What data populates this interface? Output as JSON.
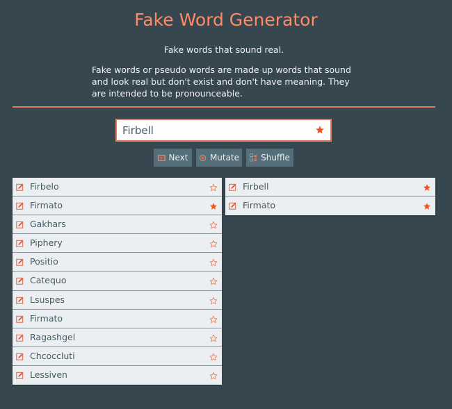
{
  "header": {
    "title": "Fake Word Generator",
    "tagline": "Fake words that sound real.",
    "description": "Fake words or pseudo words are made up words that sound and look real but don't exist and don't have meaning. They are intended to be pronounceable."
  },
  "input": {
    "value": "Firbell",
    "starred": true
  },
  "buttons": {
    "next_label": "Next",
    "mutate_label": "Mutate",
    "shuffle_label": "Shuffle"
  },
  "generated_words": [
    {
      "word": "Firbelo",
      "starred": false
    },
    {
      "word": "Firmato",
      "starred": true
    },
    {
      "word": "Gakhars",
      "starred": false
    },
    {
      "word": "Piphery",
      "starred": false
    },
    {
      "word": "Positio",
      "starred": false
    },
    {
      "word": "Catequo",
      "starred": false
    },
    {
      "word": "Lsuspes",
      "starred": false
    },
    {
      "word": "Firmato",
      "starred": false
    },
    {
      "word": "Ragashgel",
      "starred": false
    },
    {
      "word": "Chcoccluti",
      "starred": false
    },
    {
      "word": "Lessiven",
      "starred": false
    }
  ],
  "favorite_words": [
    {
      "word": "Firbell",
      "starred": true
    },
    {
      "word": "Firmato",
      "starred": true
    }
  ],
  "colors": {
    "background": "#37474f",
    "accent": "#ff8a65",
    "star": "#f4511e",
    "button": "#546e7a",
    "row": "#eceff1",
    "text": "#455a64"
  }
}
